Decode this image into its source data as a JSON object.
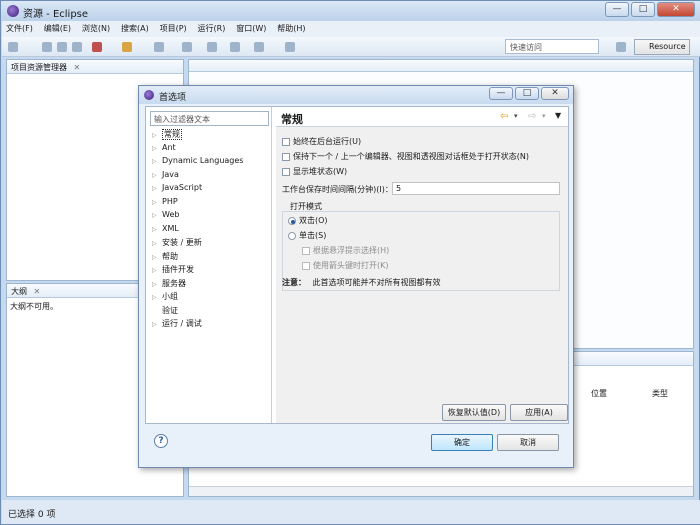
{
  "window": {
    "title": "资源 - Eclipse",
    "controls": {
      "minimize": "—",
      "maximize": "□",
      "close": "✕"
    }
  },
  "menubar": [
    "文件(F)",
    "编辑(E)",
    "浏览(N)",
    "搜索(A)",
    "项目(P)",
    "运行(R)",
    "窗口(W)",
    "帮助(H)"
  ],
  "toolbar": {
    "quick_access_placeholder": "快速访问",
    "perspective_button": "Resource"
  },
  "views": {
    "project_explorer_tab": "项目资源管理器",
    "outline_tab": "大纲",
    "outline_message": "大纲不可用。",
    "problems_columns": [
      "位置",
      "类型"
    ]
  },
  "statusbar": {
    "text": "已选择 0 项"
  },
  "dialog": {
    "title": "首选项",
    "filter_placeholder": "输入过滤器文本",
    "tree": [
      {
        "label": "常规",
        "selected": true
      },
      {
        "label": "Ant"
      },
      {
        "label": "Dynamic Languages"
      },
      {
        "label": "Java"
      },
      {
        "label": "JavaScript"
      },
      {
        "label": "PHP"
      },
      {
        "label": "Web"
      },
      {
        "label": "XML"
      },
      {
        "label": "安装 / 更新"
      },
      {
        "label": "帮助"
      },
      {
        "label": "插件开发"
      },
      {
        "label": "服务器"
      },
      {
        "label": "小组"
      },
      {
        "label": "验证",
        "no_arrow": true
      },
      {
        "label": "运行 / 调试"
      }
    ],
    "page": {
      "title": "常规",
      "options": {
        "run_in_background": "始终在后台运行(U)",
        "keep_next_prev": "保持下一个 / 上一个编辑器、视图和透视图对话框处于打开状态(N)",
        "show_heap": "显示堆状态(W)"
      },
      "interval_label": "工作台保存时间间隔(分钟)(I)：",
      "interval_value": "5",
      "open_mode": {
        "group_label": "打开模式",
        "double_click": "双击(O)",
        "single_click": "单击(S)",
        "hover_select": "根据悬浮提示选择(H)",
        "arrow_open": "使用箭头键时打开(K)"
      },
      "note_label": "注意：",
      "note_text": "此首选项可能并不对所有视图都有效",
      "restore_defaults": "恢复默认值(D)",
      "apply": "应用(A)"
    },
    "ok": "确定",
    "cancel": "取消",
    "help_icon_glyph": "?"
  },
  "colors": {
    "accent": "#3c7fb1",
    "frame": "#c5d9ef"
  }
}
